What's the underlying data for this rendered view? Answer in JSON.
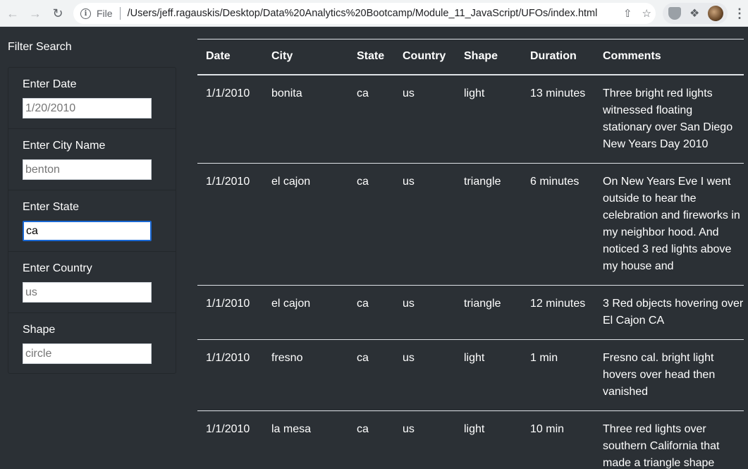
{
  "browser": {
    "scheme_label": "File",
    "url": "/Users/jeff.ragauskis/Desktop/Data%20Analytics%20Bootcamp/Module_11_JavaScript/UFOs/index.html"
  },
  "sidebar": {
    "title": "Filter Search",
    "filters": [
      {
        "label": "Enter Date",
        "placeholder": "1/20/2010",
        "value": ""
      },
      {
        "label": "Enter City Name",
        "placeholder": "benton",
        "value": ""
      },
      {
        "label": "Enter State",
        "placeholder": "",
        "value": "ca"
      },
      {
        "label": "Enter Country",
        "placeholder": "us",
        "value": ""
      },
      {
        "label": "Shape",
        "placeholder": "circle",
        "value": ""
      }
    ]
  },
  "table": {
    "headers": [
      "Date",
      "City",
      "State",
      "Country",
      "Shape",
      "Duration",
      "Comments"
    ],
    "rows": [
      [
        "1/1/2010",
        "bonita",
        "ca",
        "us",
        "light",
        "13 minutes",
        "Three bright red lights witnessed floating stationary over San Diego New Years Day 2010"
      ],
      [
        "1/1/2010",
        "el cajon",
        "ca",
        "us",
        "triangle",
        "6 minutes",
        "On New Years Eve I went outside to hear the celebration and fireworks in my neighbor hood. And noticed 3 red lights above my house and"
      ],
      [
        "1/1/2010",
        "el cajon",
        "ca",
        "us",
        "triangle",
        "12 minutes",
        "3 Red objects hovering over El Cajon CA"
      ],
      [
        "1/1/2010",
        "fresno",
        "ca",
        "us",
        "light",
        "1 min",
        "Fresno cal. bright light hovers over head then vanished"
      ],
      [
        "1/1/2010",
        "la mesa",
        "ca",
        "us",
        "light",
        "10 min",
        "Three red lights over southern California that made a triangle shape"
      ]
    ]
  }
}
